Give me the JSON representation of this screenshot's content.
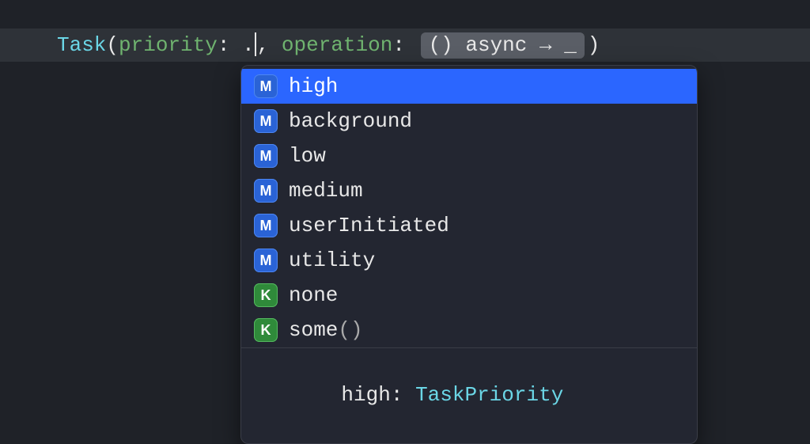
{
  "code": {
    "task": "Task",
    "open": "(",
    "param1": "priority",
    "colon": ": ",
    "dot": ".",
    "comma": ", ",
    "param2": "operation",
    "placeholder": "() async → _",
    "close": ")"
  },
  "suggestions": [
    {
      "icon": "M",
      "iconKind": "m",
      "label": "high",
      "selected": true
    },
    {
      "icon": "M",
      "iconKind": "m",
      "label": "background",
      "selected": false
    },
    {
      "icon": "M",
      "iconKind": "m",
      "label": "low",
      "selected": false
    },
    {
      "icon": "M",
      "iconKind": "m",
      "label": "medium",
      "selected": false
    },
    {
      "icon": "M",
      "iconKind": "m",
      "label": "userInitiated",
      "selected": false
    },
    {
      "icon": "M",
      "iconKind": "m",
      "label": "utility",
      "selected": false
    },
    {
      "icon": "K",
      "iconKind": "k",
      "label": "none",
      "selected": false
    },
    {
      "icon": "K",
      "iconKind": "k",
      "label": "some",
      "selected": false,
      "trailing": "()"
    }
  ],
  "detail": {
    "name": "high",
    "sep": ": ",
    "type": "TaskPriority"
  }
}
